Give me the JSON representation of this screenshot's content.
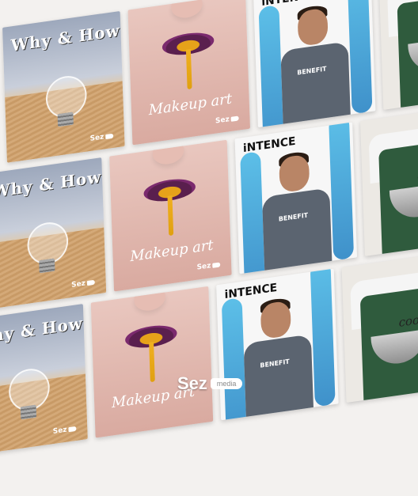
{
  "cards": {
    "bulb_title": "Why & How",
    "lips_title": "Makeup art",
    "man_title": "iNTENCE",
    "man_shirt": "BENEFIT",
    "cook_title": "cook meal",
    "brand": "Sez"
  },
  "logo": {
    "name": "Sez",
    "tag": "media"
  }
}
